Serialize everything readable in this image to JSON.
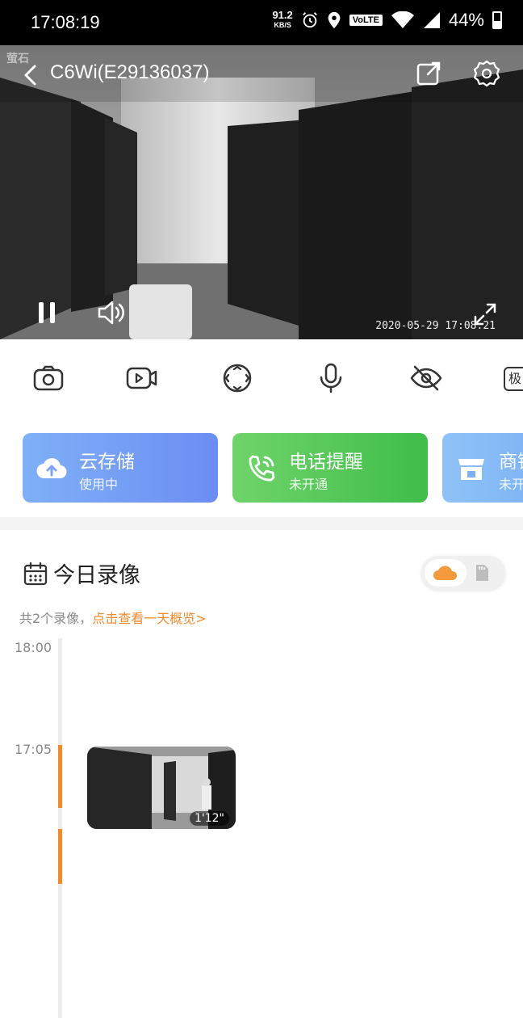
{
  "status_bar": {
    "time": "17:08:19",
    "net_speed": "91.2",
    "net_unit": "KB/S",
    "volte": "VoLTE",
    "battery": "44%"
  },
  "player": {
    "watermark": "萤石",
    "camera_title": "C6Wi(E29136037)",
    "timestamp": "2020-05-29 17:08:21",
    "icons": [
      "back-icon",
      "share-icon",
      "gear-icon",
      "pause-icon",
      "volume-icon",
      "fullscreen-icon"
    ]
  },
  "toolbar": {
    "tools": [
      "camera-icon",
      "record-icon",
      "ptz-icon",
      "microphone-icon",
      "privacy-icon",
      "quality-icon"
    ],
    "quality_label": "极"
  },
  "cards": [
    {
      "title": "云存储",
      "subtitle": "使用中",
      "icon": "cloud-upload-icon"
    },
    {
      "title": "电话提醒",
      "subtitle": "未开通",
      "icon": "phone-call-icon"
    },
    {
      "title": "商铺",
      "subtitle": "未开",
      "icon": "shop-icon"
    }
  ],
  "recordings": {
    "title": "今日录像",
    "summary_prefix": "共2个录像，",
    "summary_link": "点击查看一天概览>",
    "timeline_labels": [
      "18:00",
      "17:05"
    ],
    "clip_duration": "1'12\""
  },
  "colors": {
    "accent_orange": "#f08a2c",
    "cloud_card": "#6b8df3",
    "phone_card": "#3fbd4a"
  }
}
